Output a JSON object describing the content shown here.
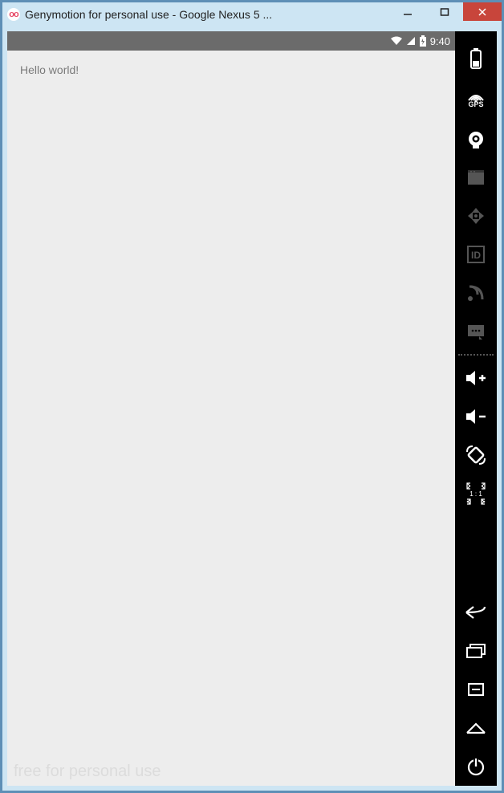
{
  "window": {
    "title": "Genymotion for personal use - Google Nexus 5 ..."
  },
  "statusbar": {
    "time": "9:40"
  },
  "app": {
    "hello": "Hello world!",
    "watermark": "free for personal use"
  },
  "toolbar": {
    "gps": "GPS",
    "scale": "1 : 1"
  }
}
